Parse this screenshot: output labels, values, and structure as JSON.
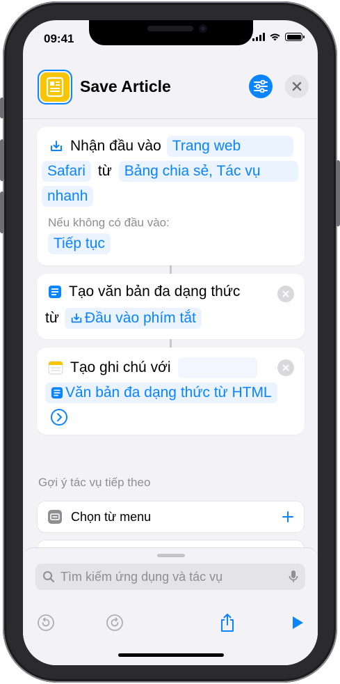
{
  "status": {
    "time": "09:41"
  },
  "header": {
    "title": "Save Article"
  },
  "actions": [
    {
      "label": "Nhận đầu vào",
      "type_token": "Trang web",
      "type_token_cont": "Safari",
      "from_word": "từ",
      "source_token": "Bảng chia sẻ, Tác vụ",
      "source_token_cont": "nhanh",
      "if_no_input_label": "Nếu không có đầu vào:",
      "fallback_token": "Tiếp tục"
    },
    {
      "label": "Tạo văn bản đa dạng thức",
      "from_word": "từ",
      "input_token": "Đầu vào phím tắt"
    },
    {
      "label": "Tạo ghi chú với",
      "content_token": "Văn bản đa dạng thức từ HTML"
    }
  ],
  "suggestions": {
    "title": "Gợi ý tác vụ tiếp theo",
    "items": [
      {
        "label": "Chọn từ menu"
      }
    ]
  },
  "search": {
    "placeholder": "Tìm kiếm ứng dụng và tác vụ"
  },
  "colors": {
    "accent": "#0a84ff",
    "icon_bg": "#f7c600",
    "background": "#f2f2f7"
  }
}
